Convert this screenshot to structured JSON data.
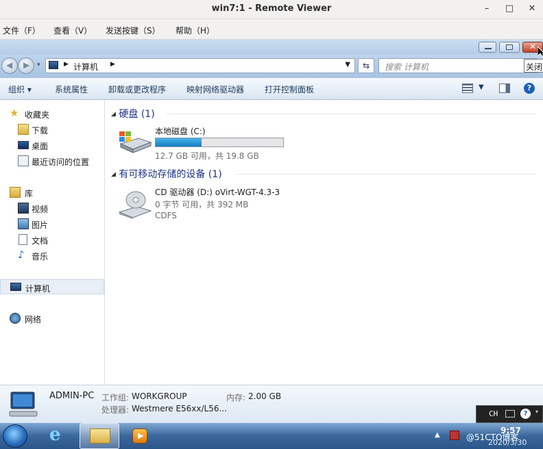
{
  "viewer": {
    "title": "win7:1 - Remote Viewer",
    "menu": [
      "文件（F）",
      "查看（V）",
      "发送按键（S）",
      "帮助（H）"
    ]
  },
  "window": {
    "close_tooltip": "关闭"
  },
  "address": {
    "crumb": "计算机",
    "search_placeholder": "搜索 计算机"
  },
  "toolbar": {
    "items": [
      "组织 ▾",
      "系统属性",
      "卸载或更改程序",
      "映射网络驱动器",
      "打开控制面板"
    ]
  },
  "nav": {
    "favorites": "收藏夹",
    "downloads": "下载",
    "desktop": "桌面",
    "recent": "最近访问的位置",
    "libraries": "库",
    "videos": "视频",
    "pictures": "图片",
    "documents": "文档",
    "music": "音乐",
    "computer": "计算机",
    "network": "网络"
  },
  "content": {
    "hdd_group": "硬盘 (1)",
    "drive_c": {
      "name": "本地磁盘 (C:)",
      "info": "12.7 GB 可用，共 19.8 GB",
      "used_fraction": 0.36
    },
    "removable_group": "有可移动存储的设备 (1)",
    "drive_d": {
      "name": "CD 驱动器 (D:) oVirt-WGT-4.3-3",
      "info": "0 字节 可用，共 392 MB",
      "fs": "CDFS"
    }
  },
  "details": {
    "pc_name": "ADMIN-PC",
    "workgroup_label": "工作组:",
    "workgroup": "WORKGROUP",
    "memory_label": "内存:",
    "memory": "2.00 GB",
    "cpu_label": "处理器:",
    "cpu": "Westmere E56xx/L56..."
  },
  "taskbar": {
    "ime": "CH",
    "clock_time": "9:57",
    "clock_date": "2020/3/30",
    "watermark": "@51CTO博客"
  },
  "colors": {
    "accent": "#1e3287",
    "bar_fill": "#1e8ac6"
  }
}
